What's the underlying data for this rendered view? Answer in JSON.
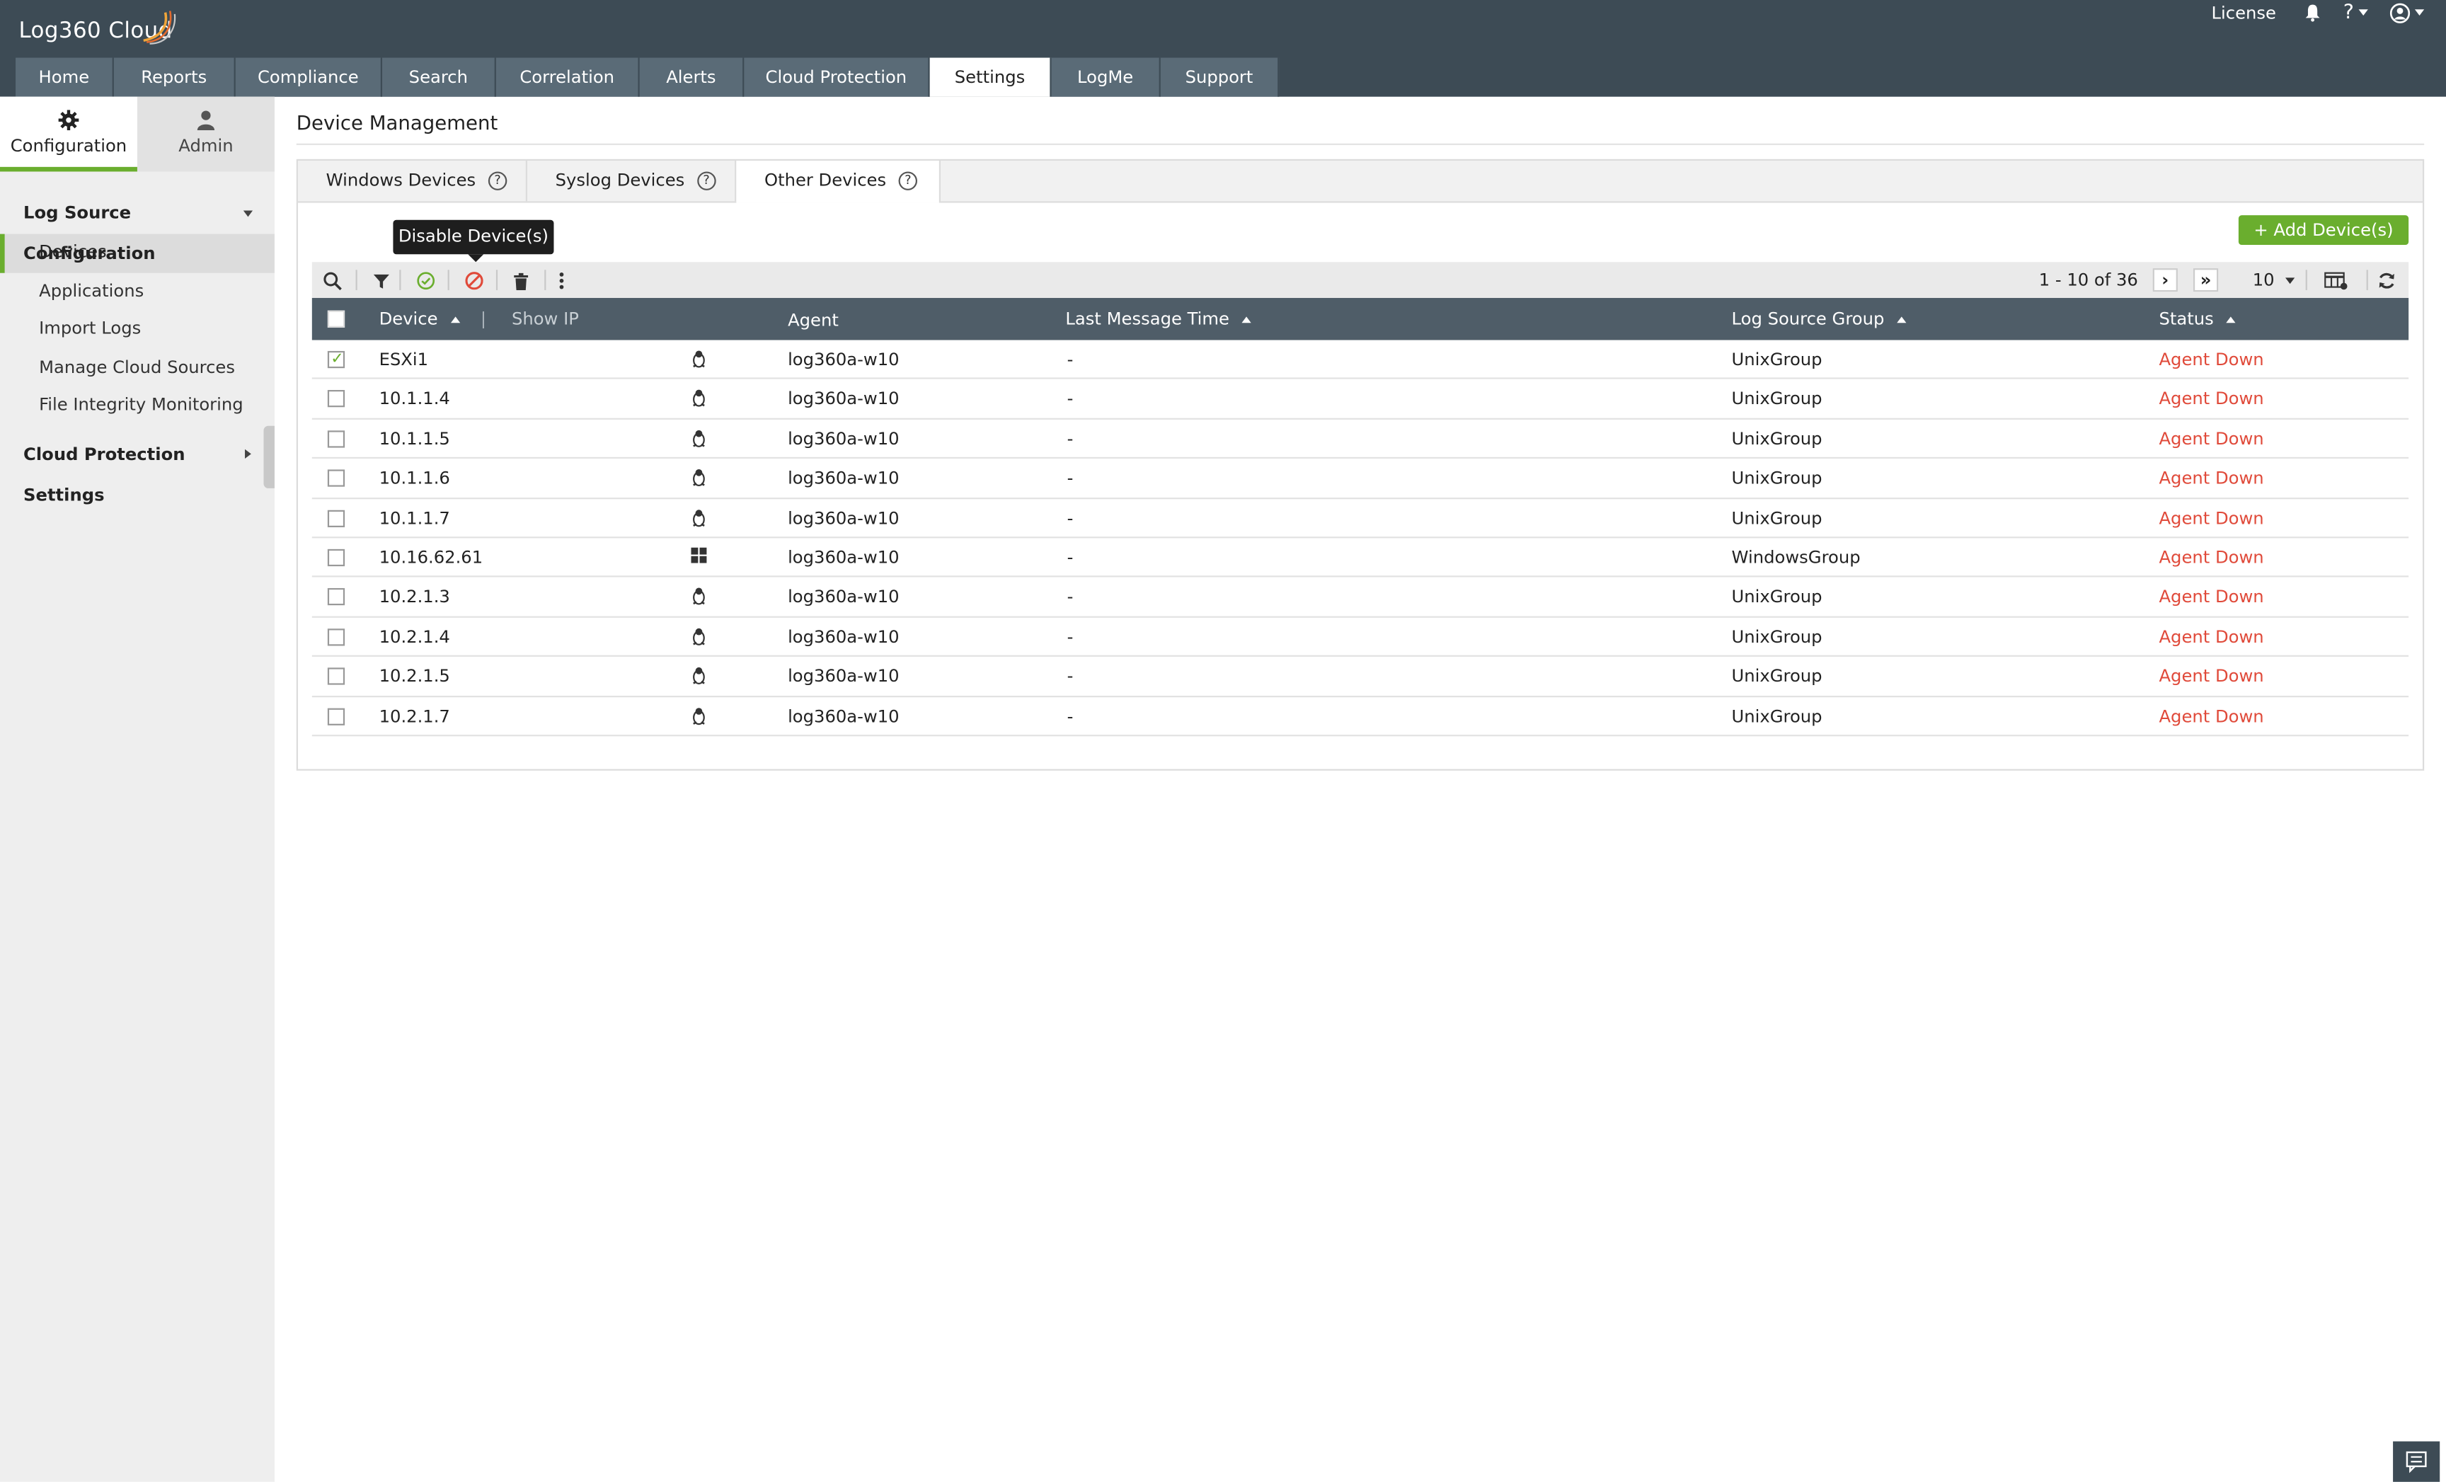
{
  "app": {
    "title_text": "Log360 Cloud",
    "license_label": "License",
    "help_label": "?",
    "accent_color": "#6aae2e",
    "header_color": "#3d4b55"
  },
  "main_tabs": [
    "Home",
    "Reports",
    "Compliance",
    "Search",
    "Correlation",
    "Alerts",
    "Cloud Protection",
    "Settings",
    "LogMe",
    "Support"
  ],
  "active_main_tab": "Settings",
  "sidebar": {
    "tabs": [
      {
        "label": "Configuration",
        "icon": "gear-icon",
        "active": true
      },
      {
        "label": "Admin",
        "icon": "user-icon",
        "active": false
      }
    ],
    "section1": "Log Source Configuration",
    "items": [
      "Devices",
      "Applications",
      "Import Logs",
      "Manage Cloud Sources",
      "File Integrity Monitoring"
    ],
    "active_item": "Devices",
    "section2": "Cloud Protection Settings"
  },
  "page": {
    "title": "Device Management",
    "sub_tabs": [
      "Windows Devices",
      "Syslog Devices",
      "Other Devices"
    ],
    "active_sub_tab": "Other Devices",
    "add_button": "+ Add Device(s)",
    "tooltip": "Disable Device(s)",
    "pager": "1 - 10 of 36",
    "page_size": "10"
  },
  "table": {
    "headers": {
      "device": "Device",
      "show_ip": "Show IP",
      "agent": "Agent",
      "last_message": "Last Message Time",
      "group": "Log Source Group",
      "status": "Status"
    },
    "rows": [
      {
        "device": "ESXi1",
        "os": "linux",
        "agent": "log360a-w10",
        "last": "-",
        "group": "UnixGroup",
        "status": "Agent Down",
        "checked": true
      },
      {
        "device": "10.1.1.4",
        "os": "linux",
        "agent": "log360a-w10",
        "last": "-",
        "group": "UnixGroup",
        "status": "Agent Down",
        "checked": false
      },
      {
        "device": "10.1.1.5",
        "os": "linux",
        "agent": "log360a-w10",
        "last": "-",
        "group": "UnixGroup",
        "status": "Agent Down",
        "checked": false
      },
      {
        "device": "10.1.1.6",
        "os": "linux",
        "agent": "log360a-w10",
        "last": "-",
        "group": "UnixGroup",
        "status": "Agent Down",
        "checked": false
      },
      {
        "device": "10.1.1.7",
        "os": "linux",
        "agent": "log360a-w10",
        "last": "-",
        "group": "UnixGroup",
        "status": "Agent Down",
        "checked": false
      },
      {
        "device": "10.16.62.61",
        "os": "windows",
        "agent": "log360a-w10",
        "last": "-",
        "group": "WindowsGroup",
        "status": "Agent Down",
        "checked": false
      },
      {
        "device": "10.2.1.3",
        "os": "linux",
        "agent": "log360a-w10",
        "last": "-",
        "group": "UnixGroup",
        "status": "Agent Down",
        "checked": false
      },
      {
        "device": "10.2.1.4",
        "os": "linux",
        "agent": "log360a-w10",
        "last": "-",
        "group": "UnixGroup",
        "status": "Agent Down",
        "checked": false
      },
      {
        "device": "10.2.1.5",
        "os": "linux",
        "agent": "log360a-w10",
        "last": "-",
        "group": "UnixGroup",
        "status": "Agent Down",
        "checked": false
      },
      {
        "device": "10.2.1.7",
        "os": "linux",
        "agent": "log360a-w10",
        "last": "-",
        "group": "UnixGroup",
        "status": "Agent Down",
        "checked": false
      }
    ]
  }
}
